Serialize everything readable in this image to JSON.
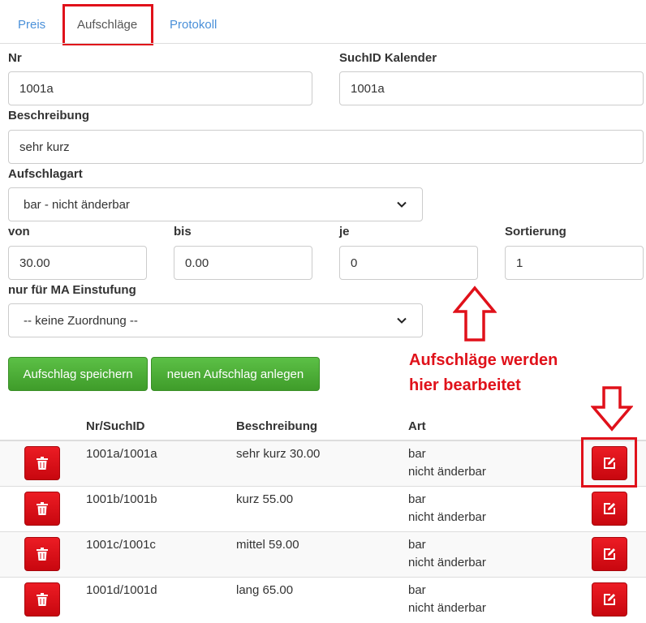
{
  "tabs": [
    {
      "label": "Preis"
    },
    {
      "label": "Aufschläge",
      "active": true
    },
    {
      "label": "Protokoll"
    }
  ],
  "form": {
    "nr": {
      "label": "Nr",
      "value": "1001a"
    },
    "suchid": {
      "label": "SuchID Kalender",
      "value": "1001a"
    },
    "beschreibung": {
      "label": "Beschreibung",
      "value": "sehr kurz"
    },
    "aufschlagart": {
      "label": "Aufschlagart",
      "selected": "bar - nicht änderbar"
    },
    "von": {
      "label": "von",
      "value": "30.00"
    },
    "bis": {
      "label": "bis",
      "value": "0.00"
    },
    "je": {
      "label": "je",
      "value": "0"
    },
    "sortierung": {
      "label": "Sortierung",
      "value": "1"
    },
    "ma_einstufung": {
      "label": "nur für MA Einstufung",
      "selected": "-- keine Zuordnung --"
    }
  },
  "buttons": {
    "save": "Aufschlag speichern",
    "new": "neuen Aufschlag anlegen"
  },
  "annotation": {
    "line1": "Aufschläge werden",
    "line2": "hier bearbeitet",
    "color": "#e0111a"
  },
  "table": {
    "headers": {
      "nr": "Nr/SuchID",
      "beschreibung": "Beschreibung",
      "art": "Art"
    },
    "rows": [
      {
        "nr": "1001a/1001a",
        "beschreibung": "sehr kurz 30.00",
        "art1": "bar",
        "art2": "nicht änderbar"
      },
      {
        "nr": "1001b/1001b",
        "beschreibung": "kurz 55.00",
        "art1": "bar",
        "art2": "nicht änderbar"
      },
      {
        "nr": "1001c/1001c",
        "beschreibung": "mittel 59.00",
        "art1": "bar",
        "art2": "nicht änderbar"
      },
      {
        "nr": "1001d/1001d",
        "beschreibung": "lang 65.00",
        "art1": "bar",
        "art2": "nicht änderbar"
      }
    ]
  },
  "icons": {
    "delete": "trash-icon",
    "edit": "edit-icon",
    "select": "chevron-down-icon"
  },
  "colors": {
    "link": "#4a90d9",
    "green": "#4cae37",
    "red": "#d9151c",
    "annotation": "#e0111a"
  }
}
